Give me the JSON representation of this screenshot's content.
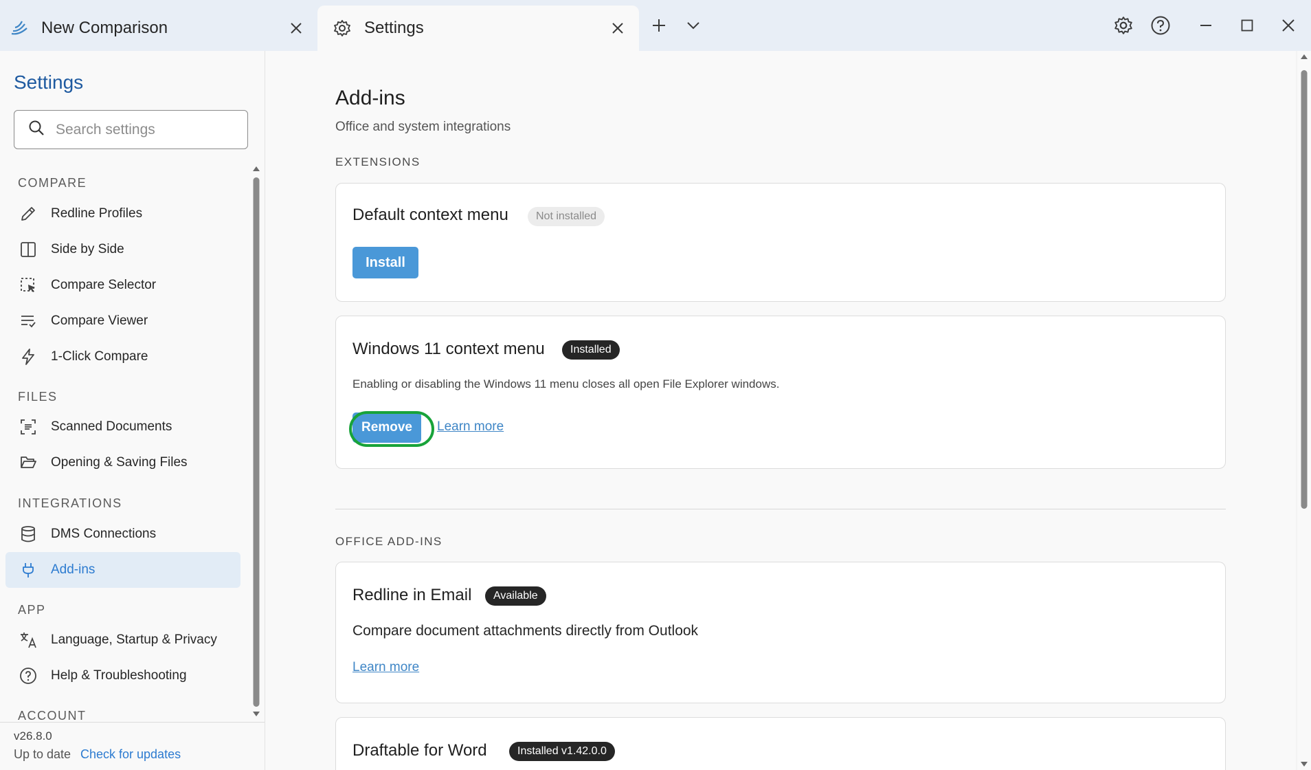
{
  "tabs": {
    "inactive_label": "New Comparison",
    "active_label": "Settings"
  },
  "sidebar": {
    "title": "Settings",
    "search_placeholder": "Search settings",
    "sections": {
      "compare": "COMPARE",
      "files": "FILES",
      "integrations": "INTEGRATIONS",
      "app": "APP",
      "account": "ACCOUNT"
    },
    "items": {
      "redline_profiles": "Redline Profiles",
      "side_by_side": "Side by Side",
      "compare_selector": "Compare Selector",
      "compare_viewer": "Compare Viewer",
      "one_click": "1-Click Compare",
      "scanned": "Scanned Documents",
      "opening_saving": "Opening & Saving Files",
      "dms": "DMS Connections",
      "addins": "Add-ins",
      "language": "Language, Startup & Privacy",
      "help": "Help & Troubleshooting"
    },
    "version": "v26.8.0",
    "update_status": "Up to date",
    "check_updates": "Check for updates"
  },
  "main": {
    "title": "Add-ins",
    "subtitle": "Office and system integrations",
    "extensions_heading": "EXTENSIONS",
    "office_heading": "OFFICE ADD-INS",
    "cards": {
      "default_menu": {
        "title": "Default context menu",
        "badge": "Not installed",
        "button": "Install"
      },
      "win11_menu": {
        "title": "Windows 11 context menu",
        "badge": "Installed",
        "description": "Enabling or disabling the Windows 11 menu closes all open File Explorer windows.",
        "button": "Remove",
        "link": "Learn more"
      },
      "redline_email": {
        "title": "Redline in Email",
        "badge": "Available",
        "description": "Compare document attachments directly from Outlook",
        "link": "Learn more"
      },
      "draftable_word": {
        "title": "Draftable for Word",
        "badge": "Installed v1.42.0.0"
      }
    }
  },
  "colors": {
    "accent": "#2c7bd0",
    "primary_button": "#4a98d8",
    "highlight_ring": "#18a33a"
  }
}
